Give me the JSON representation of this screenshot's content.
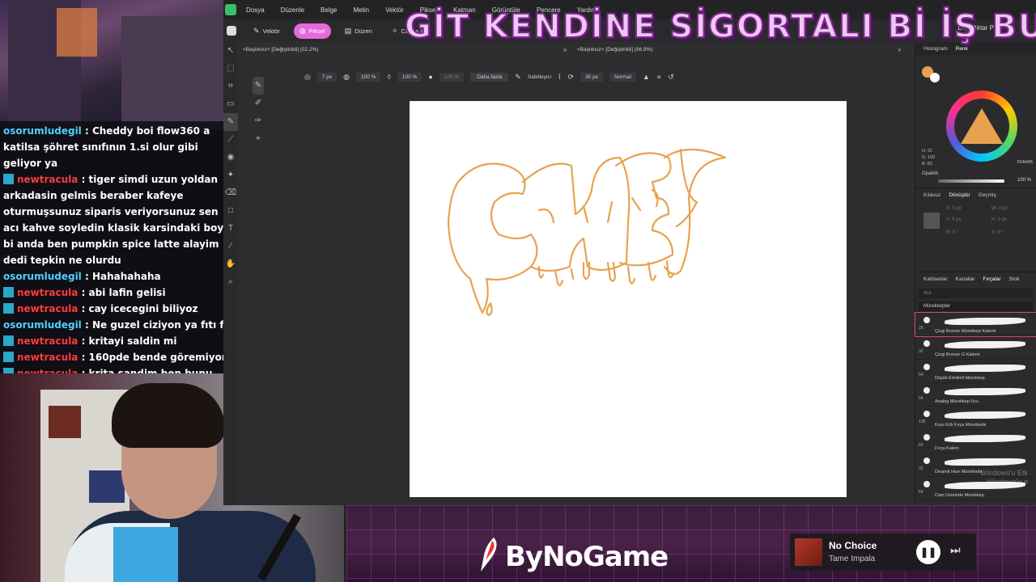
{
  "banner": "GİT KENDİNE SİGORTALI Bİ İŞ BUL",
  "menu": [
    "Dosya",
    "Düzenle",
    "Belge",
    "Metin",
    "Vektör",
    "Piksel",
    "Katman",
    "Görüntüle",
    "Pencere",
    "Yardım"
  ],
  "personas": [
    {
      "icon": "✎",
      "label": "Vektör"
    },
    {
      "icon": "◍",
      "label": "Piksel"
    },
    {
      "icon": "▤",
      "label": "Düzen"
    },
    {
      "icon": "✧",
      "label": "Canva AI"
    }
  ],
  "export_label": "Dışa Aktar PNG",
  "doc_tabs": [
    "<Başlıksız> [Değiştirildi] (52.2%)",
    "<Başlıksız> [Değiştirildi] (86.9%)"
  ],
  "context": {
    "size": "7 px",
    "opacity": "100 %",
    "flow": "100 %",
    "hardness": "100 %",
    "more": "Daha fazla",
    "stabilizer": "Sabitleyici",
    "stab_val": "35 px",
    "blend": "Normal"
  },
  "chat": [
    {
      "user": "osorumludegil",
      "color": "blue",
      "badge": false,
      "text": "Cheddy boi flow360 a katilsa şöhret sınıfının 1.si olur gibi geliyor ya"
    },
    {
      "user": "newtracula",
      "color": "red",
      "badge": true,
      "text": "tiger simdi uzun yoldan arkadasin gelmis beraber kafeye oturmuşsunuz siparis veriyorsunuz sen acı kahve soyledin klasik karsindaki boyle bi anda ben pumpkin spice latte alayim dedi tepkin ne olurdu"
    },
    {
      "user": "osorumludegil",
      "color": "blue",
      "badge": false,
      "text": "Hahahahaha"
    },
    {
      "user": "newtracula",
      "color": "red",
      "badge": true,
      "text": "abi lafin gelisi"
    },
    {
      "user": "newtracula",
      "color": "red",
      "badge": true,
      "text": "cay icecegini biliyoz"
    },
    {
      "user": "osorumludegil",
      "color": "blue",
      "badge": false,
      "text": "Ne guzel ciziyon ya fıtı fıtı"
    },
    {
      "user": "newtracula",
      "color": "red",
      "badge": true,
      "text": "kritayi saldin mi"
    },
    {
      "user": "newtracula",
      "color": "red",
      "badge": true,
      "text": "160pde bende göremiyom"
    },
    {
      "user": "newtracula",
      "color": "red",
      "badge": true,
      "text": "krita sandim ben bunu"
    }
  ],
  "panel": {
    "top_tabs": [
      "Histogram",
      "Renk"
    ],
    "hsb": [
      "H: 31",
      "S: 100",
      "B: 83"
    ],
    "hex": "FFA445",
    "opacity_label": "Opaklık",
    "opacity_val": "100 %",
    "xf_tabs": [
      "Kılavuz",
      "Dönüştür",
      "Geçmiş"
    ],
    "xf_fields": [
      "X: 0 px",
      "Y: 0 px",
      "R: 0 °",
      "W: 0 px",
      "H: 0 px",
      "S: 0 °"
    ],
    "brush_tabs": [
      "Katmanlar",
      "Kanallar",
      "Fırçalar",
      "Stok"
    ],
    "search_placeholder": "Ara",
    "category": "Mürekkepler",
    "brushes": [
      {
        "size": "28",
        "name": "Çizgi Roman Mürekkep Kalemi"
      },
      {
        "size": "32",
        "name": "Çizgi Roman G Kalemi"
      },
      {
        "size": "64",
        "name": "Düşük Emilimli Mürekkep"
      },
      {
        "size": "64",
        "name": "Analog Mürekkep Ucu"
      },
      {
        "size": "128",
        "name": "Kuru Kıllı Fırça Mürekkebi"
      },
      {
        "size": "64",
        "name": "Fırça Kalem"
      },
      {
        "size": "32",
        "name": "Dinamit Hize Mürekkebi"
      },
      {
        "size": "64",
        "name": "Cam Üzerinde Mürekkep"
      }
    ]
  },
  "drawing_text": "CHED",
  "brand": "ByNoGame",
  "player": {
    "song": "No Choice",
    "artist": "Tame Impala"
  },
  "watermark": [
    "Windows'u Etk",
    "Windows'u e"
  ],
  "colors": {
    "accent": "#e66ad9",
    "stroke": "#e8a24f"
  }
}
